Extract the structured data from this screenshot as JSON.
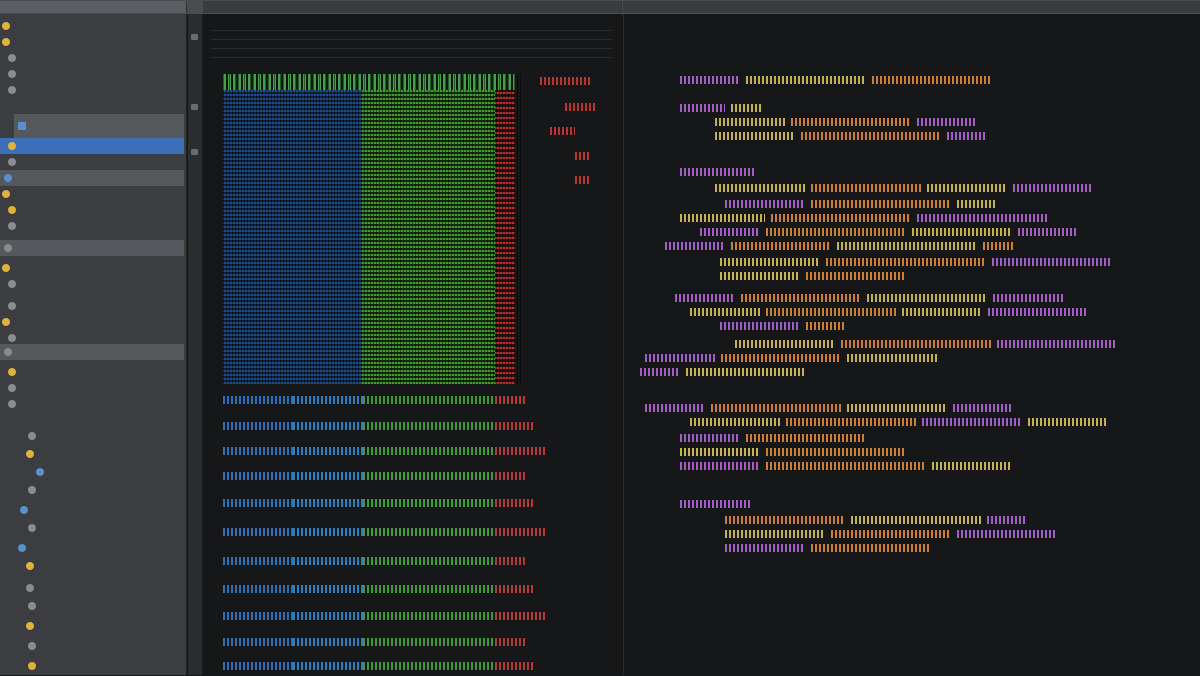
{
  "colors": {
    "sidebar_bg": "#3b3d40",
    "selection": "#3d6fb8",
    "editor_bg": "#161718",
    "accent_blue": "#1f4d8a",
    "accent_green": "#3e9a2e",
    "accent_red": "#b72f2f"
  },
  "sidebar": {
    "items": []
  },
  "right_pane": {
    "header": ""
  }
}
